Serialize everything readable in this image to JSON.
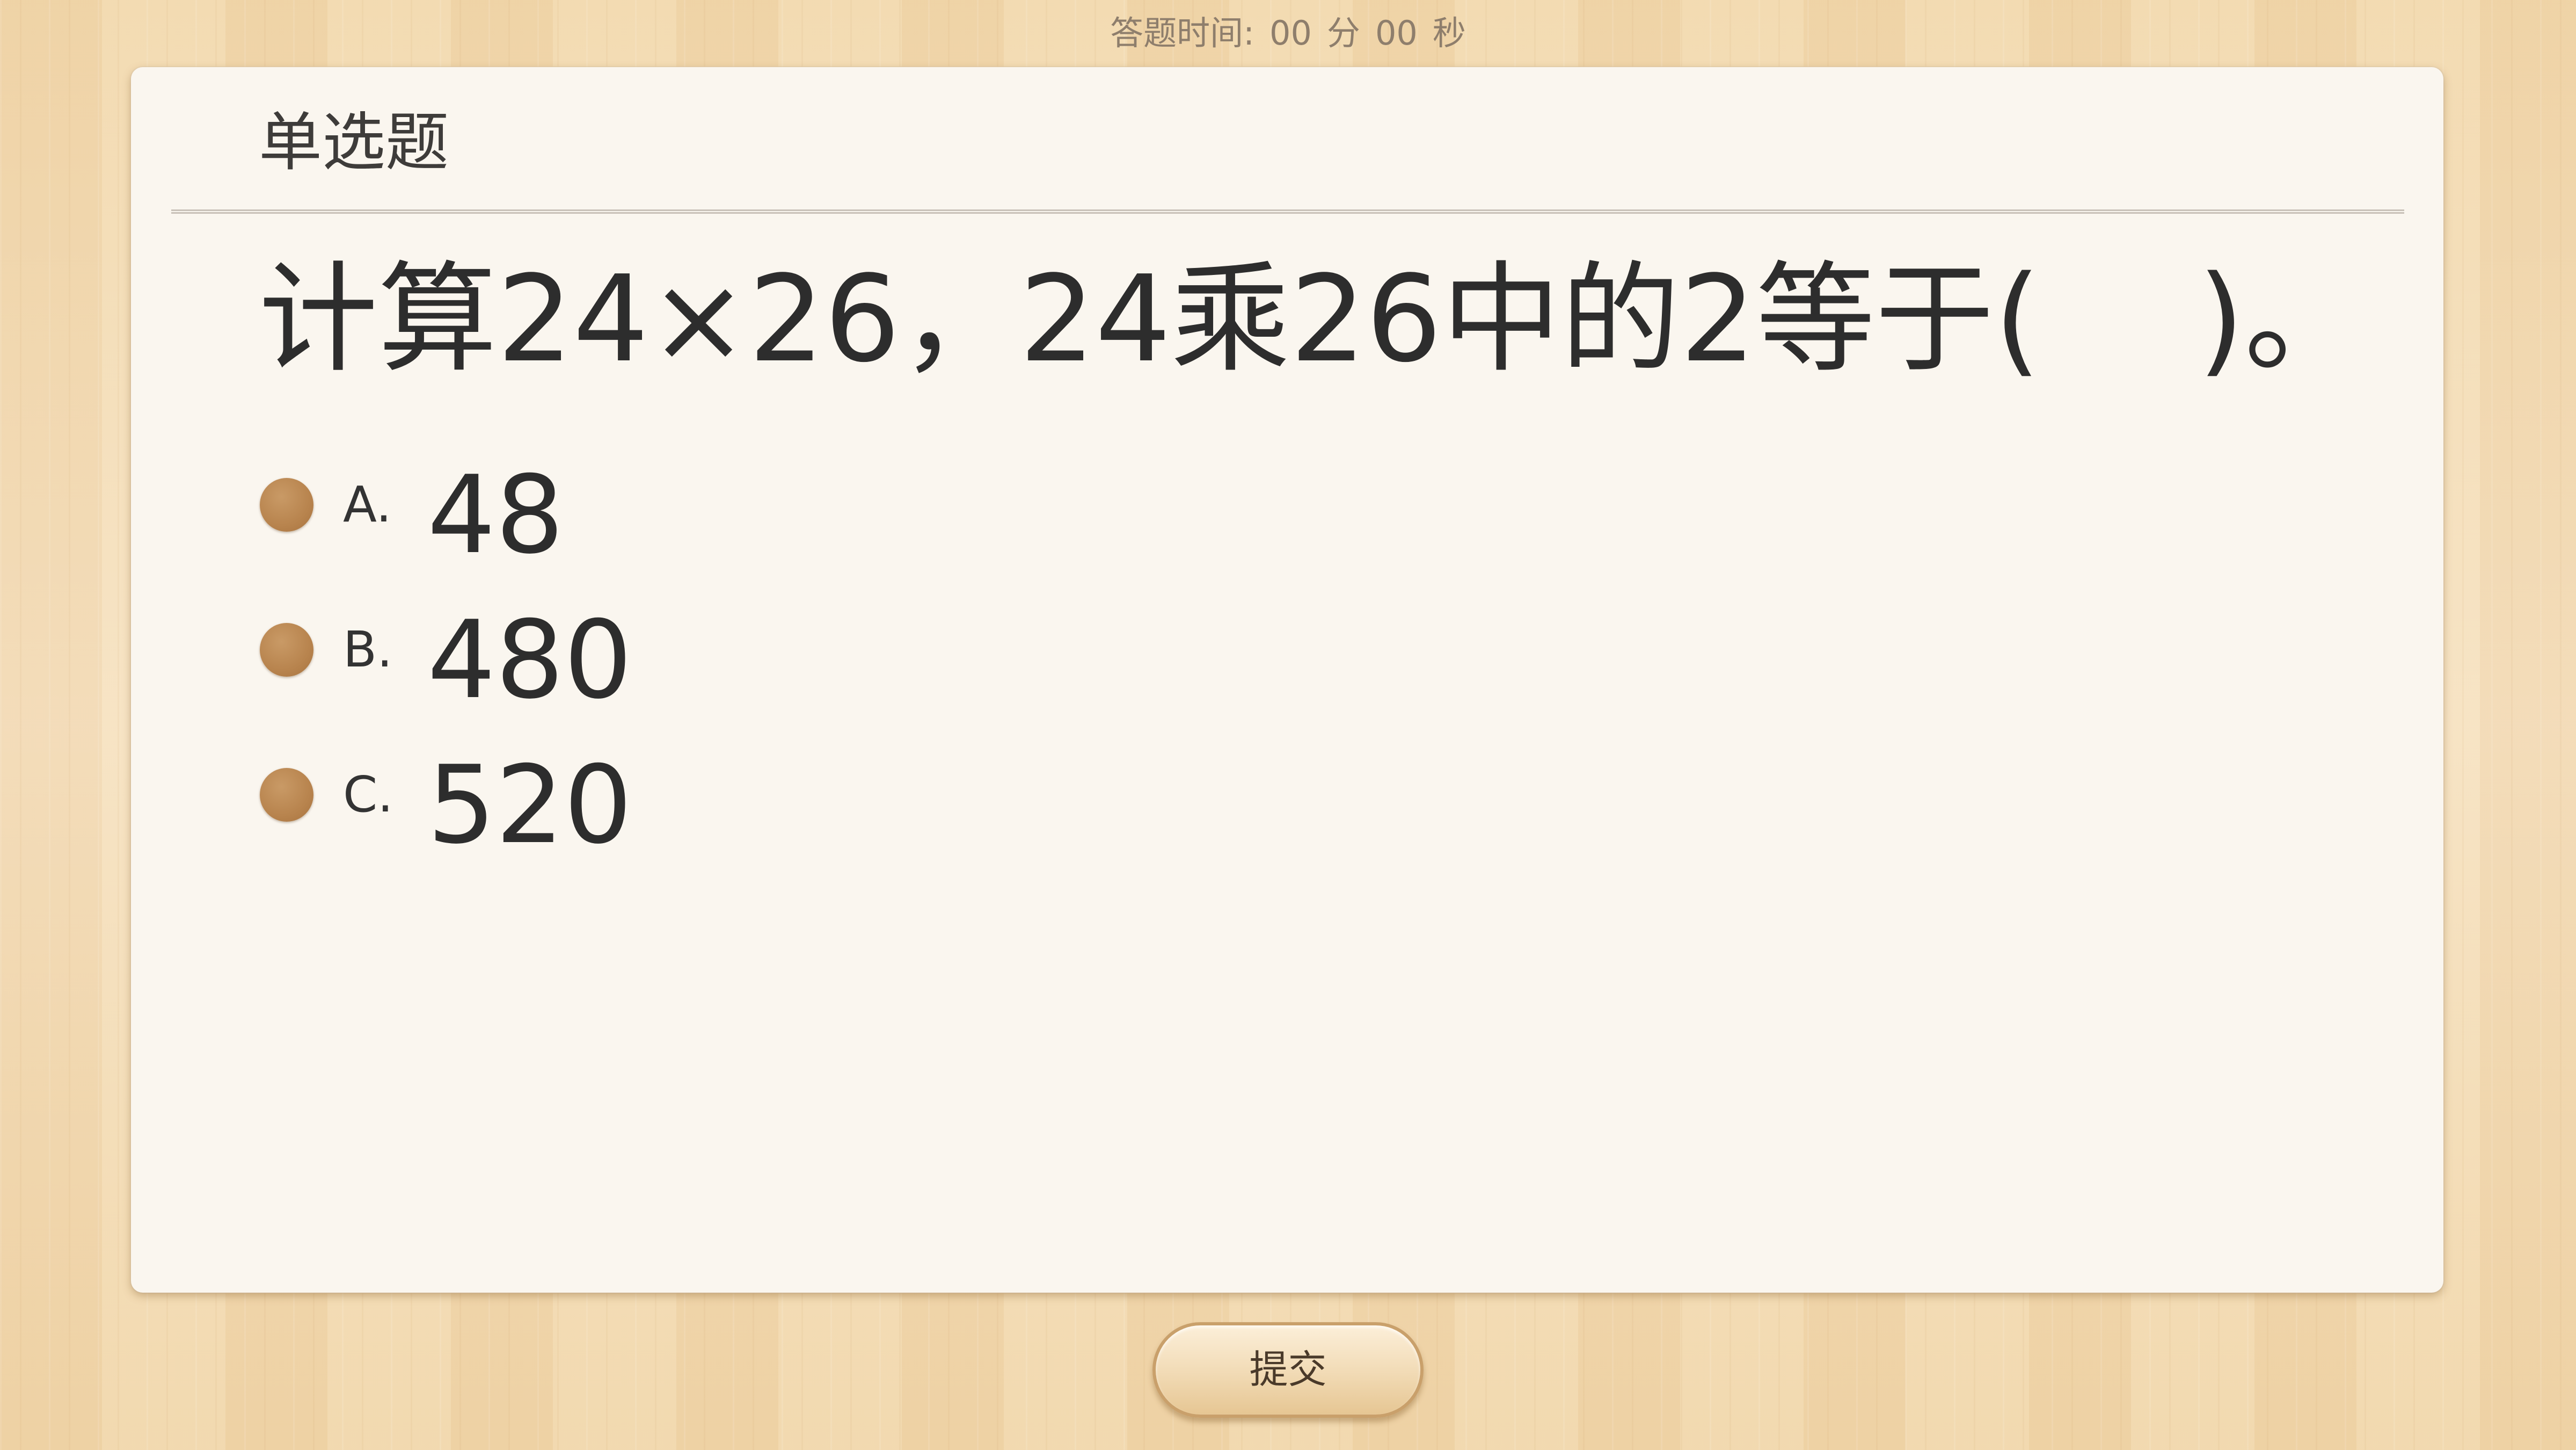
{
  "timer": {
    "label": "答题时间:",
    "minutes": "00",
    "minutes_unit": "分",
    "seconds": "00",
    "seconds_unit": "秒"
  },
  "question": {
    "type_label": "单选题",
    "text": "计算24×26，24乘26中的2等于(　 )。",
    "options": [
      {
        "letter": "A.",
        "value": "48"
      },
      {
        "letter": "B.",
        "value": "480"
      },
      {
        "letter": "C.",
        "value": "520"
      }
    ]
  },
  "submit_label": "提交",
  "colors": {
    "radio": "#b8844e",
    "card_background": "#faf6ef",
    "wood_background": "#f3dcb6"
  }
}
